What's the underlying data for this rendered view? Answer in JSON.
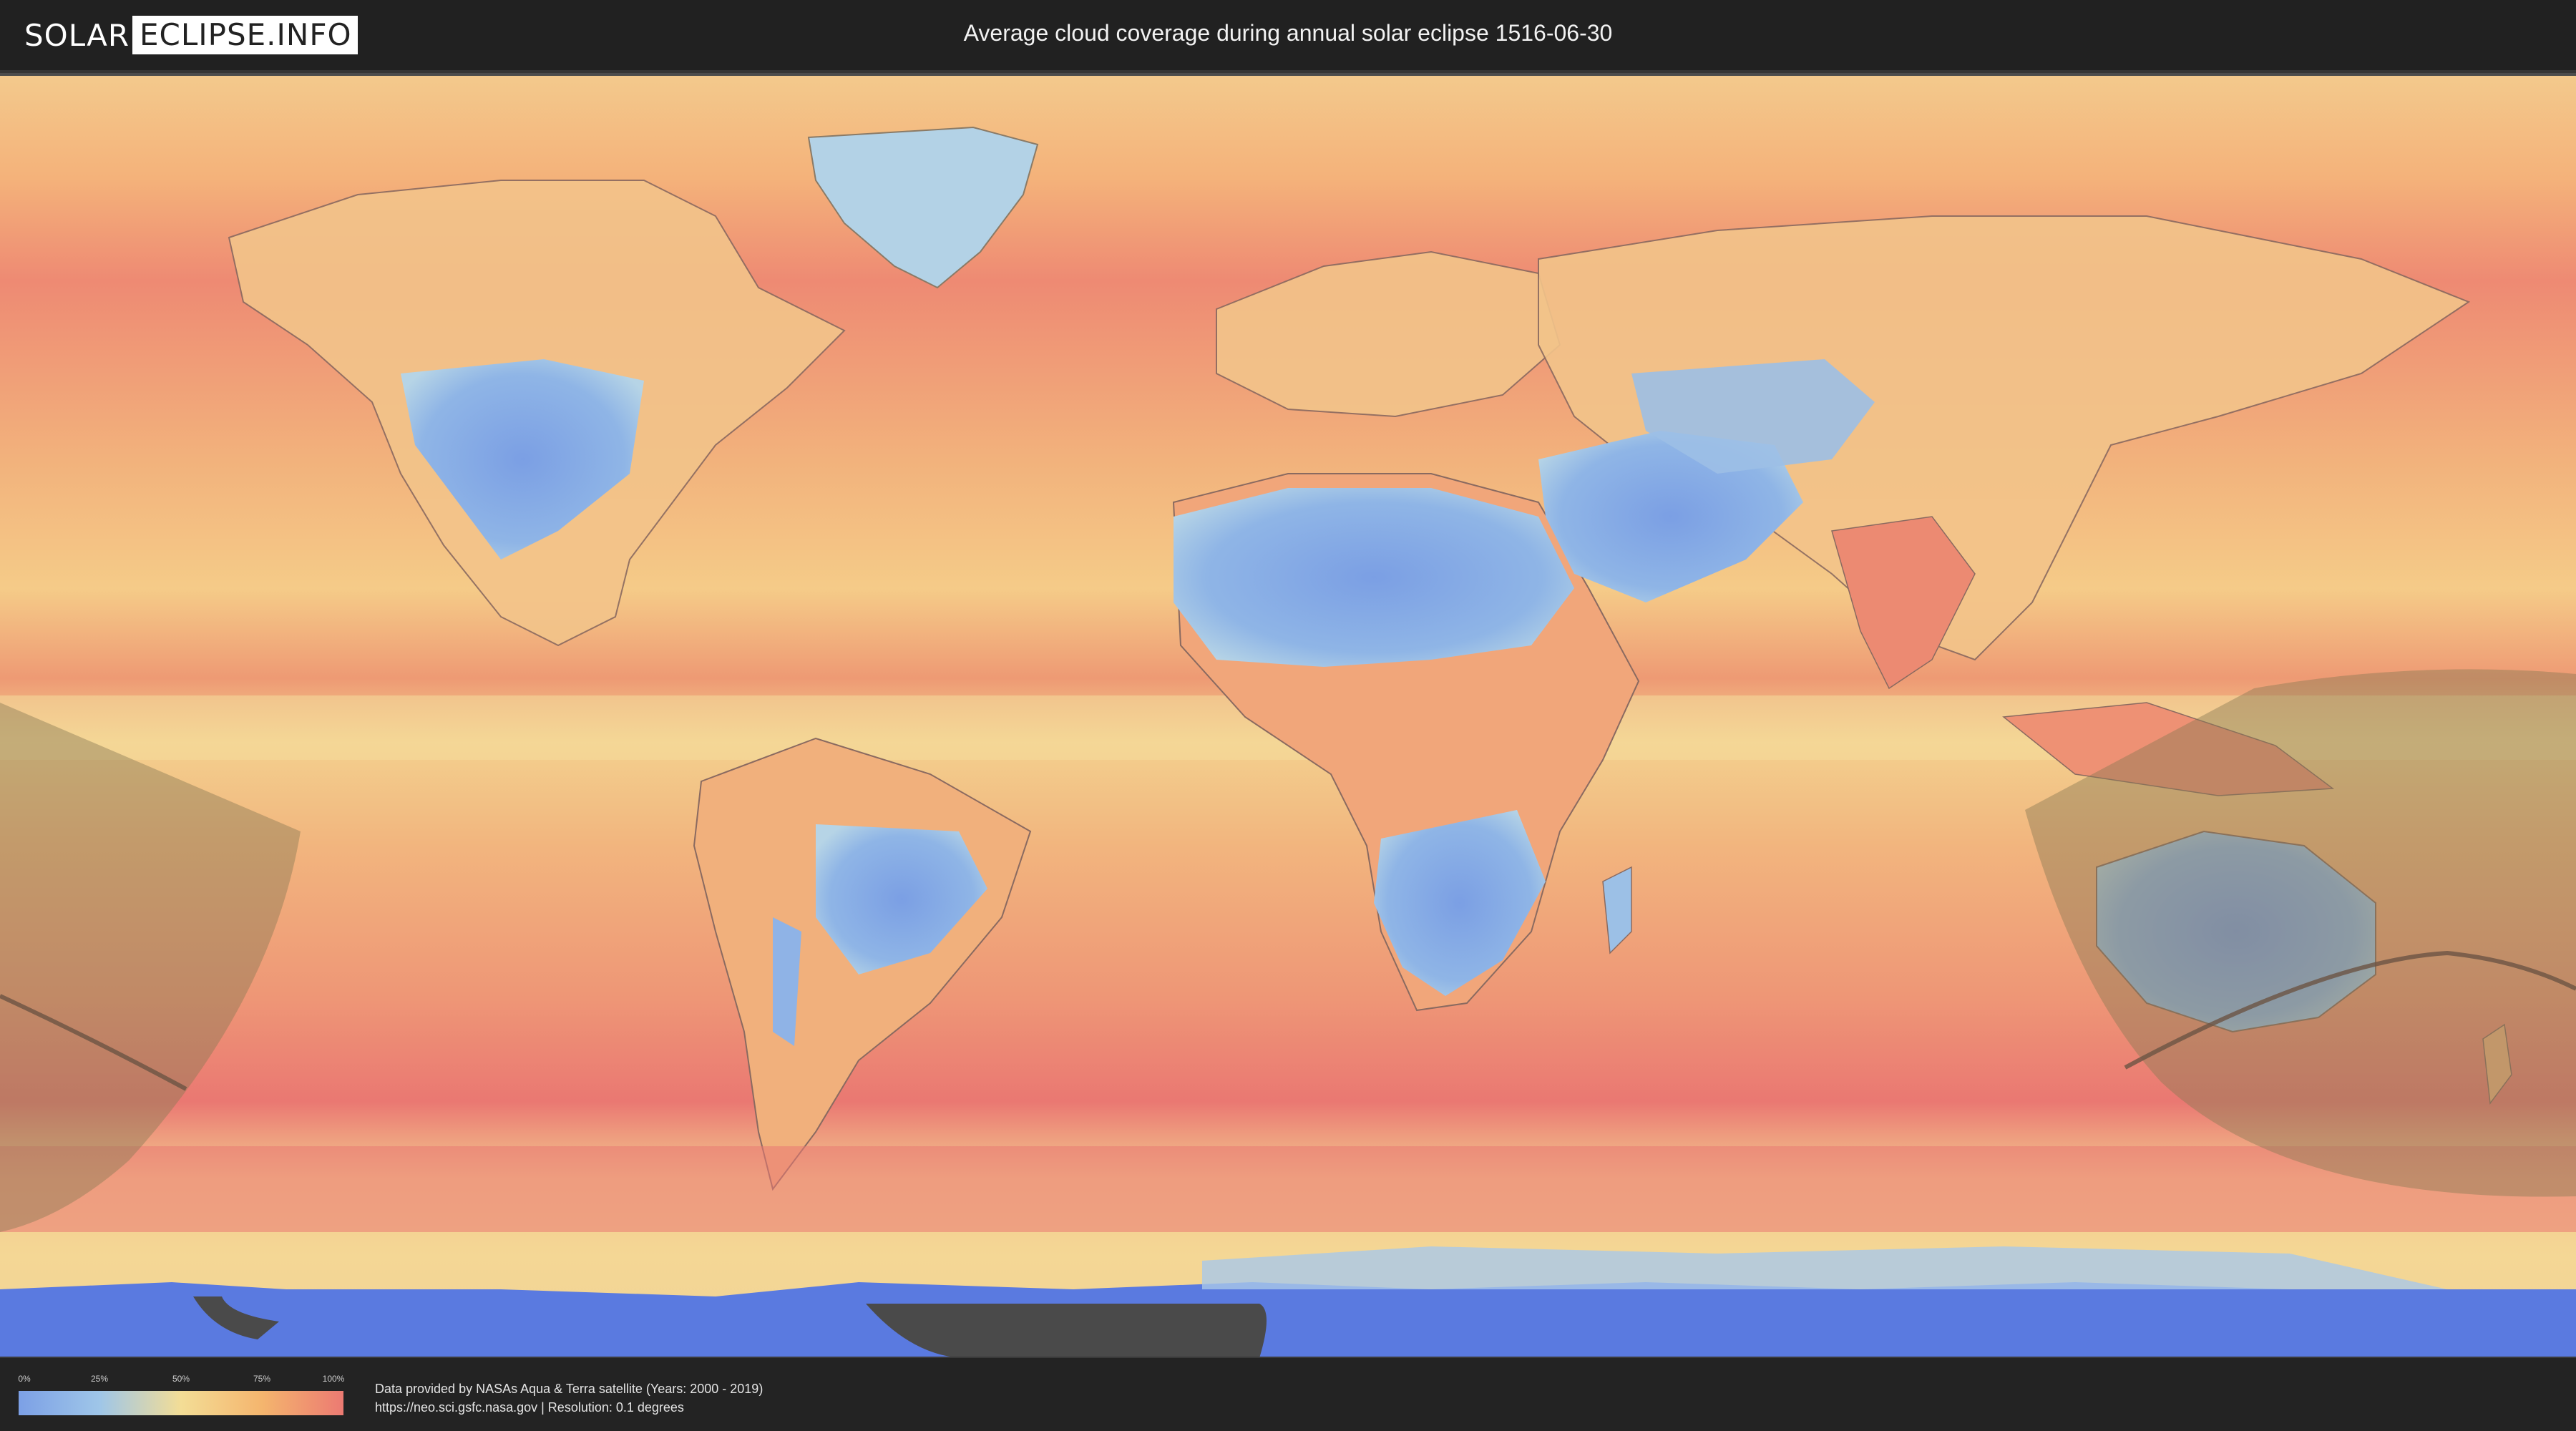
{
  "header": {
    "logo_part1": "SOLAR",
    "logo_part2": "ECLIPSE.INFO",
    "title": "Average cloud coverage during annual solar eclipse 1516-06-30"
  },
  "legend": {
    "ticks": [
      "0%",
      "25%",
      "50%",
      "75%",
      "100%"
    ],
    "colors": [
      "#7ca0e6",
      "#9fc6e8",
      "#f3dd96",
      "#f4b56e",
      "#ec7a72"
    ]
  },
  "credits": {
    "line1": "Data provided by NASAs Aqua & Terra satellite (Years: 2000 - 2019)",
    "line2": "https://neo.sci.gsfc.nasa.gov | Resolution: 0.1 degrees"
  },
  "map": {
    "colors": {
      "clear": "#7ca0e6",
      "low": "#a8cbe8",
      "mid": "#f4d795",
      "high": "#ef9a73",
      "full": "#ea7872",
      "antarctica": "#5a7ae0",
      "shadow": "#8a7a55"
    }
  }
}
